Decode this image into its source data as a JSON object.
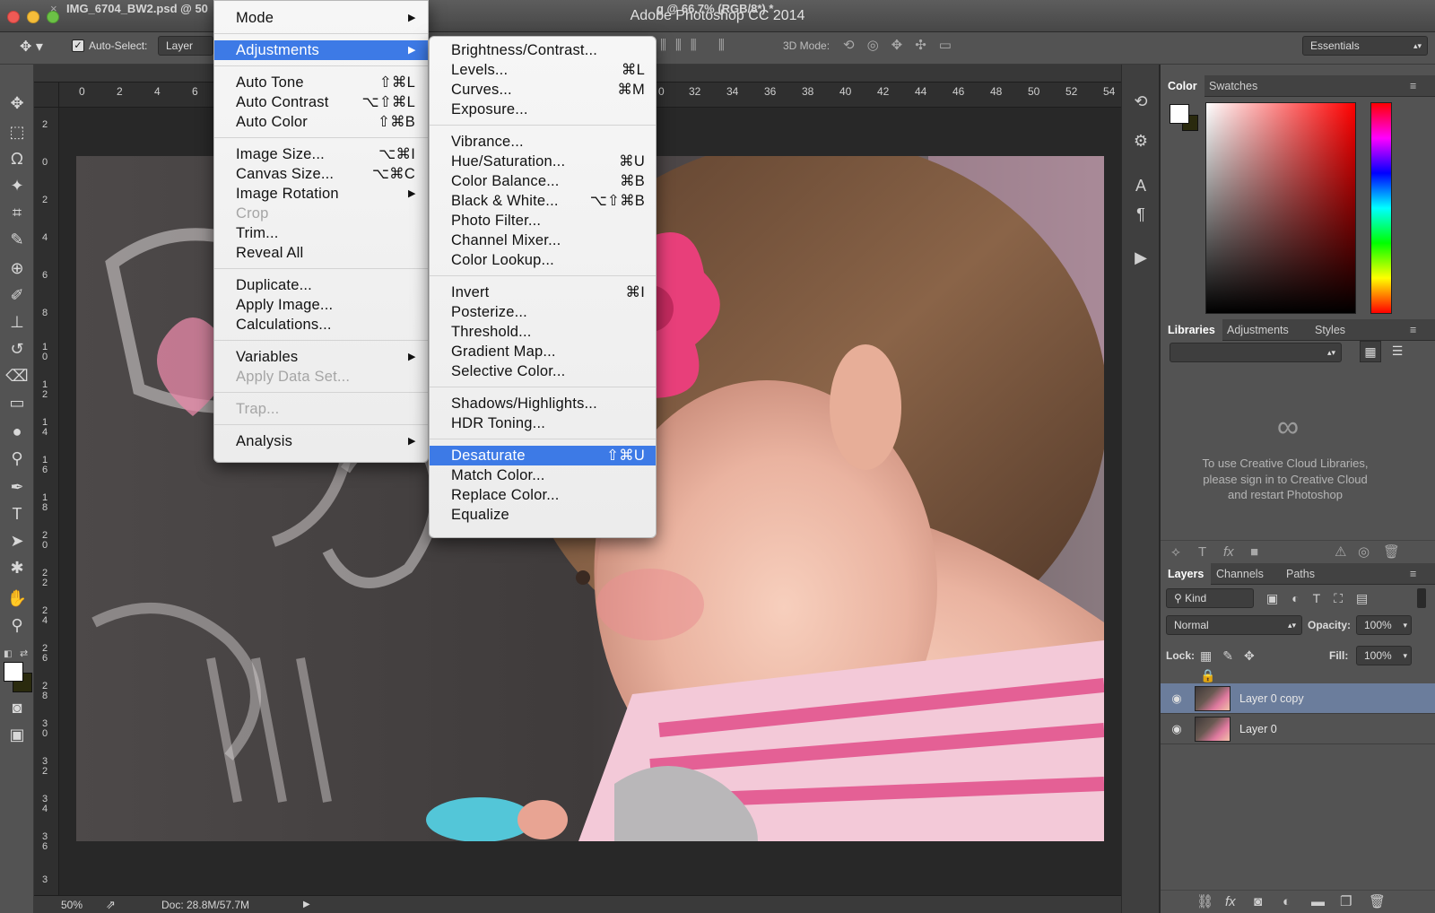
{
  "app": {
    "window_title": "Adobe Photoshop CC 2014"
  },
  "colors": {
    "menu_highlight": "#3d7ae6",
    "panel_bg": "#535353",
    "canvas_bg": "#282828"
  },
  "options_bar": {
    "auto_select_label": "Auto-Select:",
    "auto_select_target": "Layer",
    "three_d_mode_label": "3D Mode:",
    "workspace": "Essentials"
  },
  "document": {
    "tab_label_1": "IMG_6704_BW2.psd @ 50",
    "tab_label_2": "g @ 66.7% (RGB/8*) *"
  },
  "rulers": {
    "h_left": [
      "0",
      "2",
      "4",
      "6"
    ],
    "h_right": [
      "0",
      "32",
      "34",
      "36",
      "38",
      "40",
      "42",
      "44",
      "46",
      "48",
      "50",
      "52",
      "54"
    ],
    "v": [
      "2",
      "0",
      "2",
      "4",
      "6",
      "8",
      "10",
      "12",
      "14",
      "16",
      "18",
      "20",
      "22",
      "24",
      "26",
      "28",
      "30",
      "32",
      "34",
      "36",
      "3"
    ]
  },
  "status": {
    "zoom": "50%",
    "doc_size": "Doc: 28.8M/57.7M"
  },
  "menu_main": {
    "items": [
      {
        "label": "Mode",
        "arrow": "▶"
      },
      {
        "label": "Adjustments",
        "arrow": "▶"
      },
      {
        "label": "Auto Tone",
        "shortcut": "⇧⌘L"
      },
      {
        "label": "Auto Contrast",
        "shortcut": "⌥⇧⌘L"
      },
      {
        "label": "Auto Color",
        "shortcut": "⇧⌘B"
      },
      {
        "label": "Image Size...",
        "shortcut": "⌥⌘I"
      },
      {
        "label": "Canvas Size...",
        "shortcut": "⌥⌘C"
      },
      {
        "label": "Image Rotation",
        "arrow": "▶"
      },
      {
        "label": "Crop"
      },
      {
        "label": "Trim..."
      },
      {
        "label": "Reveal All"
      },
      {
        "label": "Duplicate..."
      },
      {
        "label": "Apply Image..."
      },
      {
        "label": "Calculations..."
      },
      {
        "label": "Variables",
        "arrow": "▶"
      },
      {
        "label": "Apply Data Set..."
      },
      {
        "label": "Trap..."
      },
      {
        "label": "Analysis",
        "arrow": "▶"
      }
    ]
  },
  "menu_adjust": {
    "items": [
      {
        "label": "Brightness/Contrast..."
      },
      {
        "label": "Levels...",
        "shortcut": "⌘L"
      },
      {
        "label": "Curves...",
        "shortcut": "⌘M"
      },
      {
        "label": "Exposure..."
      },
      {
        "label": "Vibrance..."
      },
      {
        "label": "Hue/Saturation...",
        "shortcut": "⌘U"
      },
      {
        "label": "Color Balance...",
        "shortcut": "⌘B"
      },
      {
        "label": "Black & White...",
        "shortcut": "⌥⇧⌘B"
      },
      {
        "label": "Photo Filter..."
      },
      {
        "label": "Channel Mixer..."
      },
      {
        "label": "Color Lookup..."
      },
      {
        "label": "Invert",
        "shortcut": "⌘I"
      },
      {
        "label": "Posterize..."
      },
      {
        "label": "Threshold..."
      },
      {
        "label": "Gradient Map..."
      },
      {
        "label": "Selective Color..."
      },
      {
        "label": "Shadows/Highlights..."
      },
      {
        "label": "HDR Toning..."
      },
      {
        "label": "Desaturate",
        "shortcut": "⇧⌘U"
      },
      {
        "label": "Match Color..."
      },
      {
        "label": "Replace Color..."
      },
      {
        "label": "Equalize"
      }
    ]
  },
  "color_panel": {
    "tabs": [
      "Color",
      "Swatches"
    ]
  },
  "libraries_panel": {
    "tabs": [
      "Libraries",
      "Adjustments",
      "Styles"
    ],
    "message_1": "To use Creative Cloud Libraries,",
    "message_2": "please sign in to Creative Cloud",
    "message_3": "and restart Photoshop"
  },
  "layers_panel": {
    "tabs": [
      "Layers",
      "Channels",
      "Paths"
    ],
    "filter_kind": "Kind",
    "blend_mode": "Normal",
    "opacity_label": "Opacity:",
    "opacity_value": "100%",
    "lock_label": "Lock:",
    "fill_label": "Fill:",
    "fill_value": "100%",
    "layers": [
      {
        "name": "Layer 0 copy",
        "selected": true
      },
      {
        "name": "Layer 0",
        "selected": false
      }
    ]
  }
}
